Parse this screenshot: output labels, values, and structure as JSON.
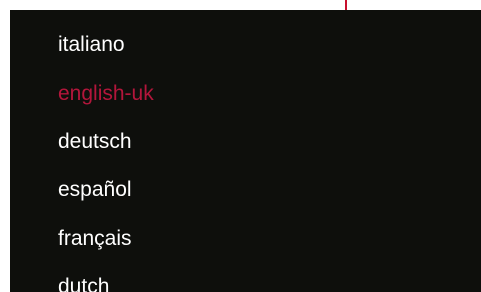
{
  "colors": {
    "panel_background": "#0e0f0c",
    "text": "#ffffff",
    "active_text": "#b3163b",
    "accent": "#c8102e"
  },
  "language_menu": {
    "selected": "english-uk",
    "items": [
      {
        "label": "italiano",
        "active": false
      },
      {
        "label": "english-uk",
        "active": true
      },
      {
        "label": "deutsch",
        "active": false
      },
      {
        "label": "español",
        "active": false
      },
      {
        "label": "français",
        "active": false
      },
      {
        "label": "dutch",
        "active": false
      }
    ]
  }
}
